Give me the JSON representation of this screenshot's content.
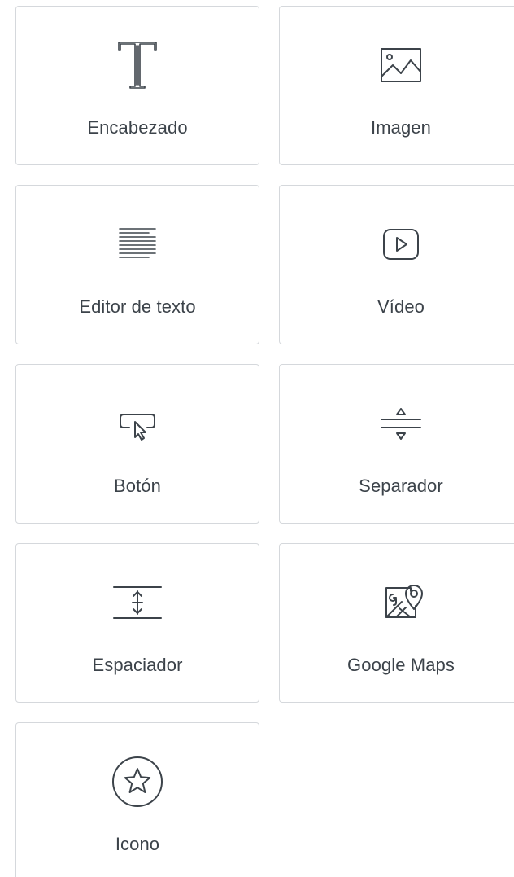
{
  "widgets": [
    {
      "label": "Encabezado",
      "icon": "heading-icon"
    },
    {
      "label": "Imagen",
      "icon": "image-icon"
    },
    {
      "label": "Editor de texto",
      "icon": "text-editor-icon"
    },
    {
      "label": "Vídeo",
      "icon": "video-icon"
    },
    {
      "label": "Botón",
      "icon": "button-icon"
    },
    {
      "label": "Separador",
      "icon": "divider-icon"
    },
    {
      "label": "Espaciador",
      "icon": "spacer-icon"
    },
    {
      "label": "Google Maps",
      "icon": "google-maps-icon"
    },
    {
      "label": "Icono",
      "icon": "star-icon"
    }
  ],
  "colors": {
    "icon": "#3c434a",
    "text": "#3c434a",
    "card_border": "#d5d8dc",
    "background": "#ffffff"
  }
}
